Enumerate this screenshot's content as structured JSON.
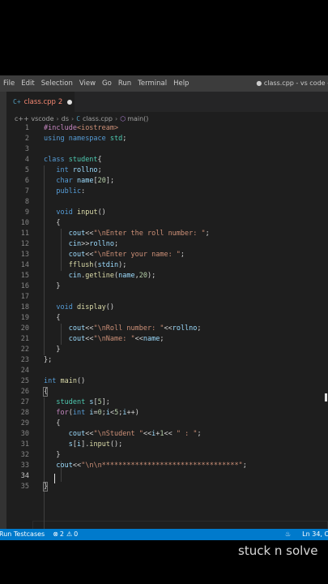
{
  "menu": [
    "File",
    "Edit",
    "Selection",
    "View",
    "Go",
    "Run",
    "Terminal",
    "Help"
  ],
  "window_title": "● class.cpp - vs code -",
  "tab": {
    "icon": "C+",
    "name": "class.cpp",
    "problems": "2"
  },
  "breadcrumb": [
    "c++ vscode",
    "ds",
    "class.cpp",
    "main()"
  ],
  "line_numbers": [
    "1",
    "2",
    "3",
    "4",
    "5",
    "6",
    "7",
    "8",
    "9",
    "10",
    "11",
    "12",
    "13",
    "14",
    "15",
    "16",
    "17",
    "18",
    "19",
    "20",
    "21",
    "22",
    "23",
    "24",
    "25",
    "26",
    "27",
    "28",
    "29",
    "30",
    "31",
    "32",
    "33",
    "34",
    "35"
  ],
  "code": {
    "l1a": "#include",
    "l1b": "<iostream>",
    "l2a": "using",
    "l2b": "namespace",
    "l2c": "std",
    "l4a": "class",
    "l4b": "student",
    "l5a": "int",
    "l5b": "rollno",
    "l6a": "char",
    "l6b": "name",
    "l6c": "20",
    "l7a": "public",
    "l9a": "void",
    "l9b": "input",
    "l11a": "cout",
    "l11b": "\"\\nEnter the roll number: \"",
    "l12a": "cin",
    "l12b": "rollno",
    "l13a": "cout",
    "l13b": "\"\\nEnter your name: \"",
    "l14a": "fflush",
    "l14b": "stdin",
    "l15a": "cin",
    "l15b": "getline",
    "l15c": "name",
    "l15d": "20",
    "l18a": "void",
    "l18b": "display",
    "l20a": "cout",
    "l20b": "\"\\nRoll number: \"",
    "l20c": "rollno",
    "l21a": "cout",
    "l21b": "\"\\nName: \"",
    "l21c": "name",
    "l25a": "int",
    "l25b": "main",
    "l27a": "student",
    "l27b": "s",
    "l27c": "5",
    "l28a": "for",
    "l28b": "int",
    "l28c": "i",
    "l28d": "0",
    "l28e": "i",
    "l28f": "5",
    "l28g": "i",
    "l30a": "cout",
    "l30b": "\"\\nStudent \"",
    "l30c": "i",
    "l30d": "1",
    "l30e": "\" : \"",
    "l31a": "s",
    "l31b": "i",
    "l31c": "input",
    "l33a": "cout",
    "l33b": "\"\\n\\n*********************************\""
  },
  "status": {
    "run_testcases": "Run Testcases",
    "errors": "2",
    "warnings": "0",
    "position": "Ln 34, Co"
  },
  "watermark": "stuck n solve"
}
